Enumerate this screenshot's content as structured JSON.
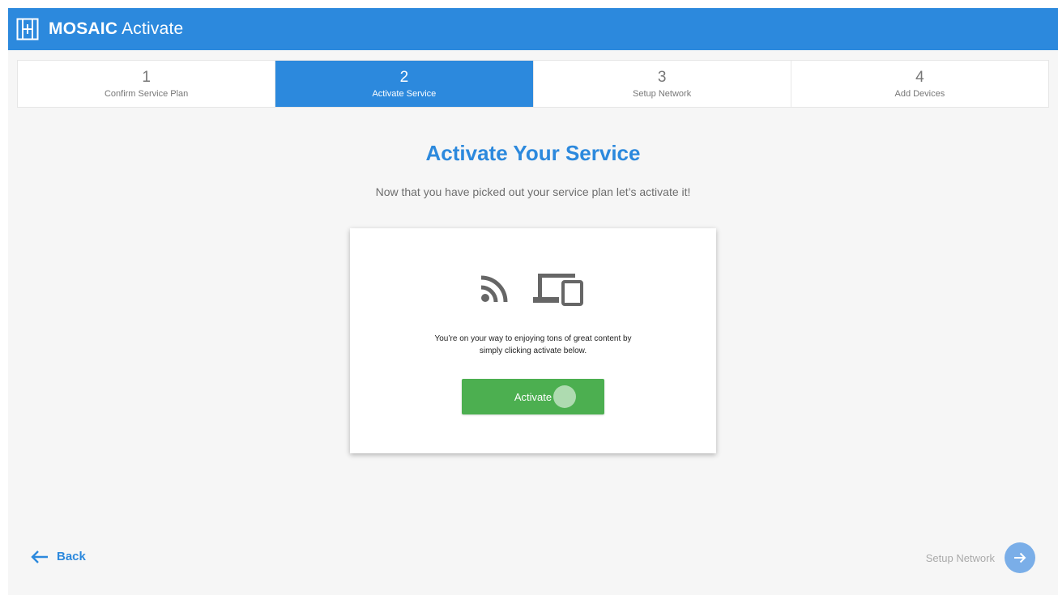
{
  "header": {
    "brand": "MOSAIC",
    "product": "Activate",
    "logo_icon": "grid-logo-icon",
    "color": "#2c89dd"
  },
  "steps": [
    {
      "number": "1",
      "label": "Confirm Service Plan",
      "active": false
    },
    {
      "number": "2",
      "label": "Activate Service",
      "active": true
    },
    {
      "number": "3",
      "label": "Setup Network",
      "active": false
    },
    {
      "number": "4",
      "label": "Add Devices",
      "active": false
    }
  ],
  "main": {
    "title": "Activate Your Service",
    "subtitle": "Now that you have picked out your service plan let’s activate it!"
  },
  "card": {
    "icons": [
      "wifi-signal-icon",
      "devices-icon"
    ],
    "text_line1": "You’re on your way to enjoying tons of great content by",
    "text_line2": "simply clicking activate below.",
    "button_label": "Activate",
    "button_color": "#4caf50"
  },
  "footer": {
    "back_label": "Back",
    "next_label": "Setup Network",
    "back_icon": "arrow-left-icon",
    "next_icon": "arrow-right-icon"
  }
}
